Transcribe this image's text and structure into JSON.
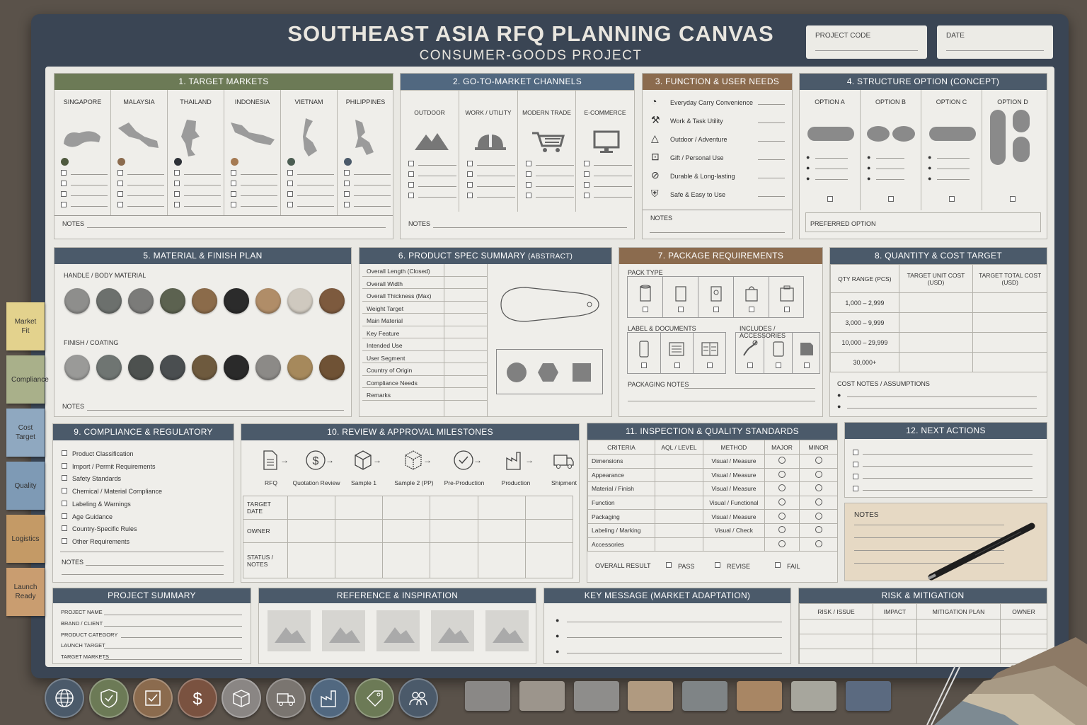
{
  "header": {
    "title": "SOUTHEAST ASIA RFQ PLANNING CANVAS",
    "subtitle": "CONSUMER-GOODS PROJECT",
    "project_code_label": "PROJECT CODE",
    "date_label": "DATE"
  },
  "markets": {
    "title": "1. TARGET MARKETS",
    "countries": [
      "SINGAPORE",
      "MALAYSIA",
      "THAILAND",
      "INDONESIA",
      "VIETNAM",
      "PHILIPPINES"
    ],
    "dot_colors": [
      "#4f5a3f",
      "#8b6b4e",
      "#2e3238",
      "#a57a52",
      "#4b5d52",
      "#4b5a6a"
    ],
    "notes_label": "NOTES"
  },
  "channels": {
    "title": "2. GO-TO-MARKET CHANNELS",
    "items": [
      "OUTDOOR",
      "WORK / UTILITY",
      "MODERN TRADE",
      "E-COMMERCE"
    ],
    "notes_label": "NOTES"
  },
  "function": {
    "title": "3. FUNCTION & USER NEEDS",
    "items": [
      "Everyday Carry Convenience",
      "Work & Task Utility",
      "Outdoor / Adventure",
      "Gift / Personal Use",
      "Durable & Long-lasting",
      "Safe & Easy to Use"
    ],
    "notes_label": "NOTES"
  },
  "structure": {
    "title": "4. STRUCTURE OPTION (CONCEPT)",
    "options": [
      "OPTION A",
      "OPTION B",
      "OPTION C",
      "OPTION D"
    ],
    "preferred_label": "PREFERRED OPTION"
  },
  "material": {
    "title": "5. MATERIAL & FINISH PLAN",
    "handle_label": "HANDLE / BODY MATERIAL",
    "finish_label": "FINISH / COATING",
    "handle_colors": [
      "#8e8e8c",
      "#6c706d",
      "#7b7b79",
      "#5c6250",
      "#8b6b4a",
      "#2b2b2b",
      "#b08d68",
      "#cfc9bf",
      "#7d5a3e"
    ],
    "finish_colors": [
      "#9a9a98",
      "#6f7572",
      "#4d514f",
      "#4a4e50",
      "#6e5a3e",
      "#2a2a2a",
      "#8c8a87",
      "#a6895c",
      "#6f5235"
    ],
    "notes_label": "NOTES"
  },
  "spec": {
    "title": "6. PRODUCT SPEC SUMMARY",
    "title_suffix": "(ABSTRACT)",
    "rows": [
      "Overall Length (Closed)",
      "Overall Width",
      "Overall Thickness (Max)",
      "Weight Target",
      "Main Material",
      "Key Feature",
      "Intended Use",
      "User Segment",
      "Country of Origin",
      "Compliance Needs",
      "Remarks"
    ]
  },
  "package": {
    "title": "7. PACKAGE REQUIREMENTS",
    "pack_type_label": "PACK TYPE",
    "label_docs_label": "LABEL & DOCUMENTS",
    "includes_label": "INCLUDES / ACCESSORIES",
    "notes_label": "PACKAGING NOTES"
  },
  "quantity": {
    "title": "8. QUANTITY & COST TARGET",
    "headers": [
      "QTY RANGE (PCS)",
      "TARGET UNIT COST (USD)",
      "TARGET TOTAL COST (USD)"
    ],
    "rows": [
      "1,000 – 2,999",
      "3,000 – 9,999",
      "10,000 – 29,999",
      "30,000+"
    ],
    "notes_label": "COST NOTES / ASSUMPTIONS"
  },
  "compliance": {
    "title": "9. COMPLIANCE & REGULATORY",
    "items": [
      "Product Classification",
      "Import / Permit Requirements",
      "Safety Standards",
      "Chemical / Material Compliance",
      "Labeling & Warnings",
      "Age Guidance",
      "Country-Specific Rules",
      "Other Requirements"
    ],
    "notes_label": "NOTES"
  },
  "milestones": {
    "title": "10. REVIEW & APPROVAL MILESTONES",
    "steps": [
      "RFQ",
      "Quotation Review",
      "Sample 1",
      "Sample 2 (PP)",
      "Pre-Production",
      "Production",
      "Shipment"
    ],
    "row_labels": [
      "TARGET DATE",
      "OWNER",
      "STATUS / NOTES"
    ]
  },
  "inspection": {
    "title": "11. INSPECTION & QUALITY STANDARDS",
    "headers": [
      "CRITERIA",
      "AQL / LEVEL",
      "METHOD",
      "MAJOR",
      "MINOR"
    ],
    "rows": [
      [
        "Dimensions",
        "Visual / Measure"
      ],
      [
        "Appearance",
        "Visual / Measure"
      ],
      [
        "Material / Finish",
        "Visual / Measure"
      ],
      [
        "Function",
        "Visual / Functional"
      ],
      [
        "Packaging",
        "Visual / Measure"
      ],
      [
        "Labeling / Marking",
        "Visual / Check"
      ],
      [
        "Accessories",
        ""
      ]
    ],
    "result_label": "OVERALL RESULT",
    "results": [
      "PASS",
      "REVISE",
      "FAIL"
    ]
  },
  "next": {
    "title": "12. NEXT ACTIONS",
    "notes_label": "NOTES"
  },
  "summary": {
    "title": "PROJECT SUMMARY",
    "fields": [
      "PROJECT NAME",
      "BRAND / CLIENT",
      "PRODUCT CATEGORY",
      "LAUNCH TARGET",
      "TARGET MARKETS"
    ]
  },
  "reference": {
    "title": "REFERENCE & INSPIRATION"
  },
  "key_message": {
    "title": "KEY MESSAGE (MARKET ADAPTATION)"
  },
  "risk": {
    "title": "RISK & MITIGATION",
    "headers": [
      "RISK / ISSUE",
      "IMPACT",
      "MITIGATION PLAN",
      "OWNER"
    ]
  },
  "side_tabs": [
    {
      "label": "Market Fit",
      "color": "#e3d28d"
    },
    {
      "label": "Compliance",
      "color": "#a9b08a"
    },
    {
      "label": "Cost Target",
      "color": "#8fa8c0"
    },
    {
      "label": "Quality",
      "color": "#7e9ab5"
    },
    {
      "label": "Logistics",
      "color": "#c49a66"
    },
    {
      "label": "Launch Ready",
      "color": "#c99d70"
    }
  ],
  "bottom_icons": [
    {
      "icon": "globe-icon",
      "color": "#4b5a6a"
    },
    {
      "icon": "shield-icon",
      "color": "#6c7a56"
    },
    {
      "icon": "checklist-icon",
      "color": "#8b6b4e"
    },
    {
      "icon": "dollar-icon",
      "color": "#7a5240"
    },
    {
      "icon": "box-icon",
      "color": "#8a8684"
    },
    {
      "icon": "truck-icon",
      "color": "#7a7570"
    },
    {
      "icon": "factory-icon",
      "color": "#516880"
    },
    {
      "icon": "tag-icon",
      "color": "#6c7a56"
    },
    {
      "icon": "users-icon",
      "color": "#4b5a6a"
    }
  ],
  "chips": [
    "#8a8886",
    "#9c958c",
    "#8e8d8b",
    "#b09a80",
    "#7f8486",
    "#a88664",
    "#a7a69d",
    "#5b6a80"
  ]
}
